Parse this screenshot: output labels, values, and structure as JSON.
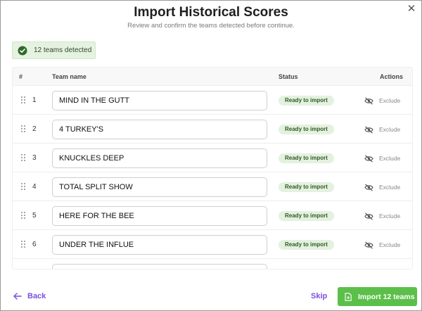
{
  "dialog": {
    "title": "Import Historical Scores",
    "subtitle": "Review and confirm the teams detected before continue.",
    "close_icon": "close-icon"
  },
  "detected": {
    "label": "12 teams detected",
    "icon": "check-circle-icon",
    "color": "#2e7d32"
  },
  "table": {
    "headers": {
      "num": "#",
      "team": "Team name",
      "status": "Status",
      "actions": "Actions"
    },
    "rows": [
      {
        "num": "1",
        "team": "MIND IN THE GUTT",
        "status": "Ready to import",
        "action": "Exclude"
      },
      {
        "num": "2",
        "team": "4 TURKEY'S",
        "status": "Ready to import",
        "action": "Exclude"
      },
      {
        "num": "3",
        "team": "KNUCKLES DEEP",
        "status": "Ready to import",
        "action": "Exclude"
      },
      {
        "num": "4",
        "team": "TOTAL SPLIT SHOW",
        "status": "Ready to import",
        "action": "Exclude"
      },
      {
        "num": "5",
        "team": "HERE FOR THE BEE",
        "status": "Ready to import",
        "action": "Exclude"
      },
      {
        "num": "6",
        "team": "UNDER THE INFLUE",
        "status": "Ready to import",
        "action": "Exclude"
      }
    ]
  },
  "footer": {
    "back_label": "Back",
    "skip_label": "Skip",
    "import_label": "Import 12 teams"
  },
  "colors": {
    "accent_purple": "#7b4fe0",
    "import_green": "#5cbf4a",
    "pill_bg": "#e4f1de",
    "pill_text": "#2f5a28"
  }
}
